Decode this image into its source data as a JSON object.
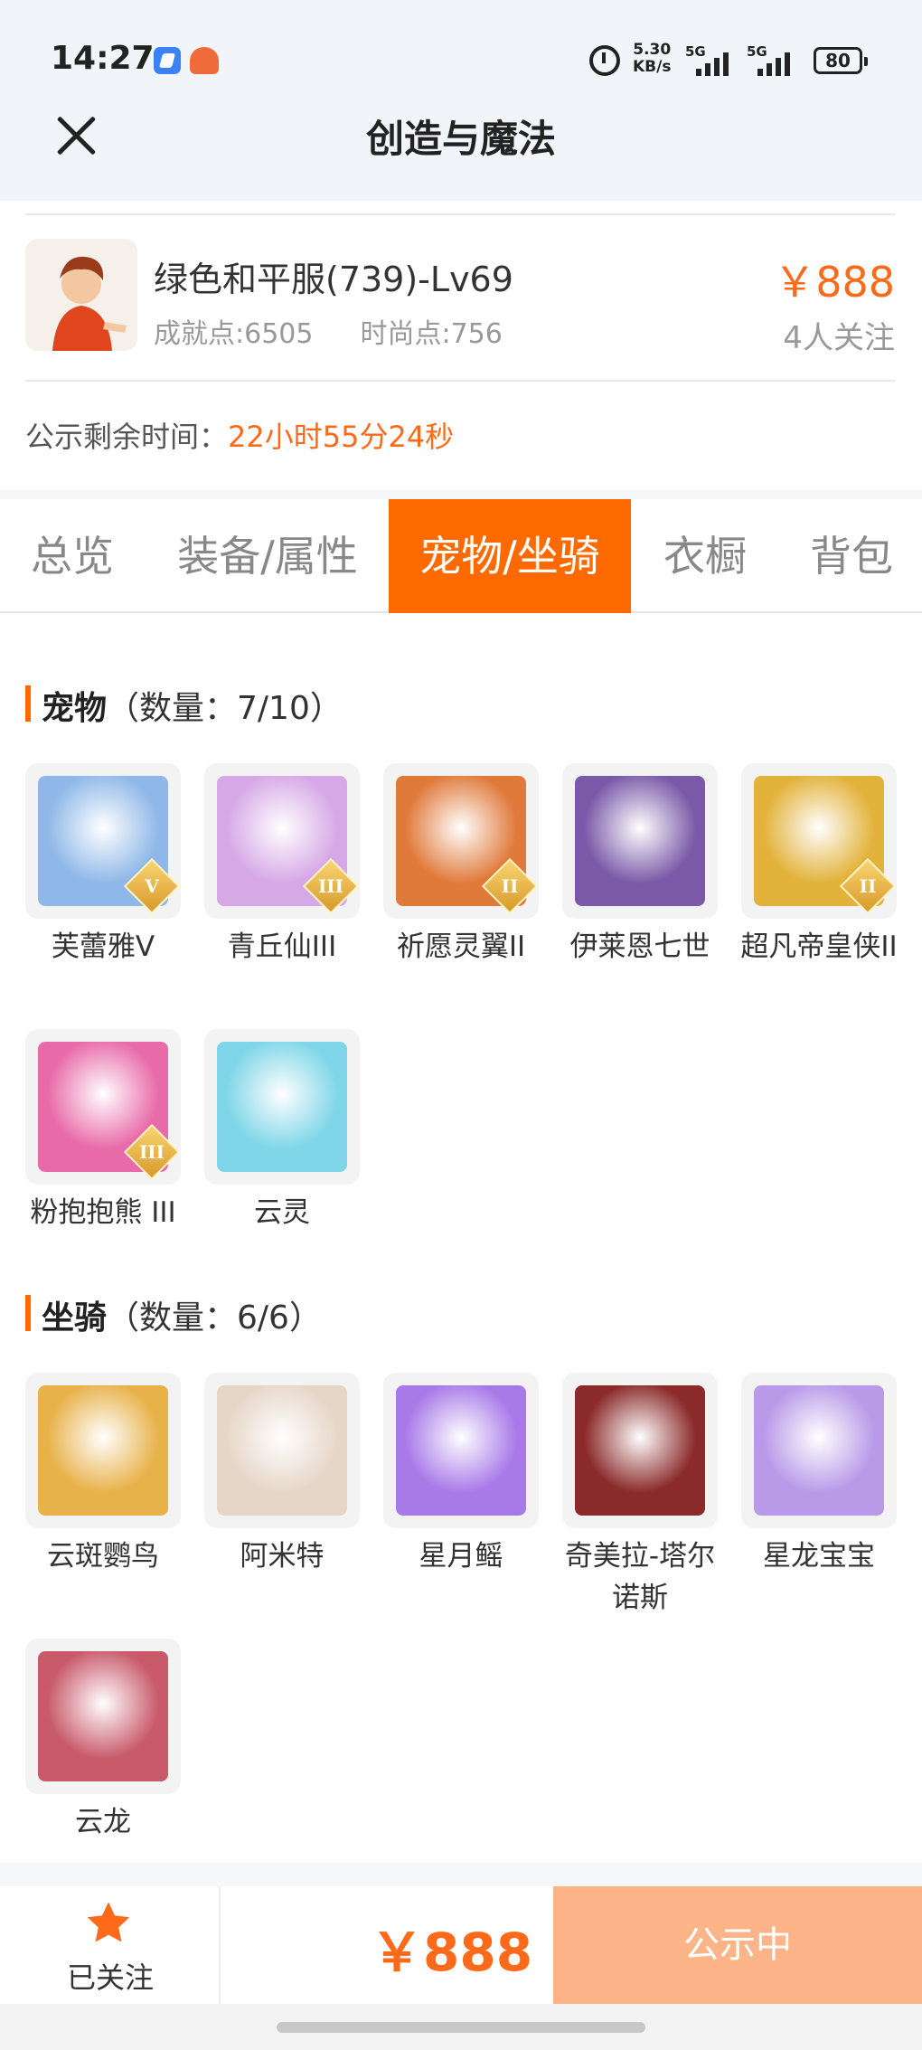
{
  "status_bar": {
    "time": "14:27",
    "net_speed_value": "5.30",
    "net_speed_unit": "KB/s",
    "signal1": "5G",
    "signal2": "5G",
    "battery": "80"
  },
  "header": {
    "title": "创造与魔法"
  },
  "account": {
    "title": "绿色和平服(739)-Lv69",
    "achievement": "成就点:6505",
    "fashion": "时尚点:756",
    "price": "￥888",
    "followers": "4人关注",
    "remain_label": "公示剩余时间：",
    "remain_value": "22小时55分24秒"
  },
  "tabs": [
    {
      "label": "总览",
      "active": false
    },
    {
      "label": "装备/属性",
      "active": false
    },
    {
      "label": "宠物/坐骑",
      "active": true
    },
    {
      "label": "衣橱",
      "active": false
    },
    {
      "label": "背包",
      "active": false
    }
  ],
  "pets": {
    "title": "宠物",
    "count": "（数量：7/10）",
    "items": [
      {
        "name": "芙蕾雅V",
        "rank": "V",
        "color": "#8fb8e8"
      },
      {
        "name": "青丘仙III",
        "rank": "III",
        "color": "#d6a8e6"
      },
      {
        "name": "祈愿灵翼II",
        "rank": "II",
        "color": "#e07a3a"
      },
      {
        "name": "伊莱恩七世",
        "rank": "",
        "color": "#7a5aa8"
      },
      {
        "name": "超凡帝皇侠II",
        "rank": "II",
        "color": "#e2b23a"
      },
      {
        "name": "粉抱抱熊 III",
        "rank": "III",
        "color": "#e86aa8"
      },
      {
        "name": "云灵",
        "rank": "",
        "color": "#7fd6e8"
      }
    ]
  },
  "mounts": {
    "title": "坐骑",
    "count": "（数量：6/6）",
    "items": [
      {
        "name": "云斑鹦鸟",
        "color": "#e8b24a"
      },
      {
        "name": "阿米特",
        "color": "#e6d6c8"
      },
      {
        "name": "星月鳐",
        "color": "#a87ae8"
      },
      {
        "name": "奇美拉-塔尔诺斯",
        "color": "#8a2a2a"
      },
      {
        "name": "星龙宝宝",
        "color": "#b89ae8"
      },
      {
        "name": "云龙",
        "color": "#c85a6a"
      }
    ]
  },
  "bottom_bar": {
    "follow_label": "已关注",
    "price": "￥888",
    "status_button": "公示中"
  },
  "colors": {
    "accent": "#ff6a00",
    "price": "#ff6a1a",
    "button_disabled": "#fcb488"
  }
}
